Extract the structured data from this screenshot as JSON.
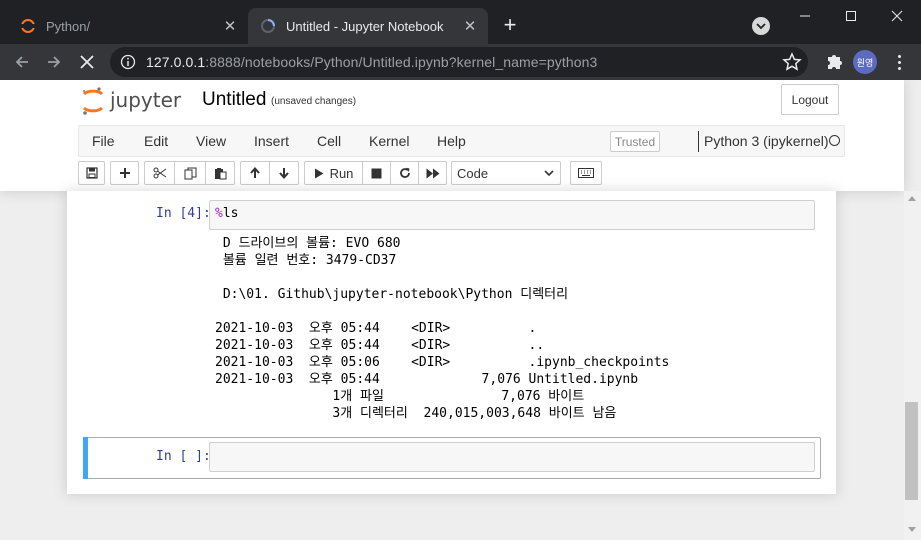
{
  "browser": {
    "tabs": [
      {
        "title": "Python/",
        "active": false
      },
      {
        "title": "Untitled - Jupyter Notebook",
        "active": true
      }
    ],
    "url_host": "127.0.0.1",
    "url_rest": ":8888/notebooks/Python/Untitled.ipynb?kernel_name=python3",
    "profile_label": "원영"
  },
  "header": {
    "logo_text": "jupyter",
    "notebook_title": "Untitled",
    "save_status": "(unsaved changes)",
    "logout_label": "Logout"
  },
  "menubar": {
    "items": [
      "File",
      "Edit",
      "View",
      "Insert",
      "Cell",
      "Kernel",
      "Help"
    ],
    "trusted_label": "Trusted",
    "kernel_name": "Python 3 (ipykernel)"
  },
  "toolbar": {
    "run_label": "Run",
    "cell_type": "Code"
  },
  "cells": [
    {
      "prompt": "In [4]:",
      "magic": "%",
      "code": "ls",
      "output": [
        " D 드라이브의 볼륨: EVO 680",
        " 볼륨 일련 번호: 3479-CD37",
        "",
        " D:\\01. Github\\jupyter-notebook\\Python 디렉터리",
        "",
        "2021-10-03  오후 05:44    <DIR>          .",
        "2021-10-03  오후 05:44    <DIR>          ..",
        "2021-10-03  오후 05:06    <DIR>          .ipynb_checkpoints",
        "2021-10-03  오후 05:44             7,076 Untitled.ipynb",
        "               1개 파일               7,076 바이트",
        "               3개 디렉터리  240,015,003,648 바이트 남음"
      ]
    },
    {
      "prompt": "In [ ]:",
      "code": ""
    }
  ],
  "colors": {
    "prompt": "#303f9f",
    "magic": "#aa22ff",
    "selected_cell_bar": "#42a5f5",
    "logo_orange": "#f37726"
  }
}
